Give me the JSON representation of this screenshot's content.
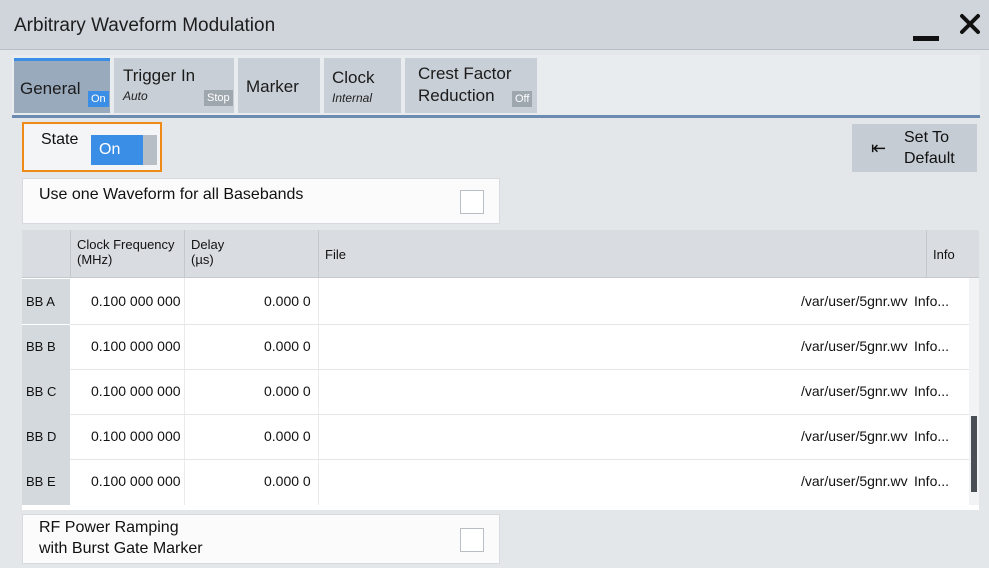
{
  "window": {
    "title": "Arbitrary Waveform Modulation",
    "minimize_icon": "minimize-icon",
    "close_icon": "close-icon"
  },
  "tabs": [
    {
      "name": "General",
      "badge": "On"
    },
    {
      "name": "Trigger In",
      "sub": "Auto",
      "badge": "Stop"
    },
    {
      "name": "Marker"
    },
    {
      "name": "Clock",
      "sub": "Internal"
    },
    {
      "name_line1": "Crest Factor",
      "name_line2": "Reduction",
      "badge": "Off"
    }
  ],
  "state": {
    "label": "State",
    "value": "On"
  },
  "set_default": {
    "line1": "Set To",
    "line2": "Default",
    "icon": "arrow-to-left-icon"
  },
  "use_one_waveform": {
    "label": "Use one Waveform for all Basebands",
    "checked": false
  },
  "table": {
    "headers": {
      "clock_line1": "Clock Frequency",
      "clock_line2": "(MHz)",
      "delay_line1": "Delay",
      "delay_line2": "(µs)",
      "file": "File",
      "info": "Info"
    },
    "rows": [
      {
        "bb": "BB A",
        "clock": "0.100 000 000",
        "delay": "0.000 0",
        "file": "/var/user/5gnr.wv",
        "info": "Info..."
      },
      {
        "bb": "BB B",
        "clock": "0.100 000 000",
        "delay": "0.000 0",
        "file": "/var/user/5gnr.wv",
        "info": "Info..."
      },
      {
        "bb": "BB C",
        "clock": "0.100 000 000",
        "delay": "0.000 0",
        "file": "/var/user/5gnr.wv",
        "info": "Info..."
      },
      {
        "bb": "BB D",
        "clock": "0.100 000 000",
        "delay": "0.000 0",
        "file": "/var/user/5gnr.wv",
        "info": "Info..."
      },
      {
        "bb": "BB E",
        "clock": "0.100 000 000",
        "delay": "0.000 0",
        "file": "/var/user/5gnr.wv",
        "info": "Info..."
      }
    ]
  },
  "rf_power_ramping": {
    "line1": "RF Power Ramping",
    "line2": "with Burst Gate Marker",
    "checked": false
  },
  "colors": {
    "accent": "#3a8ee6",
    "highlight": "#f08a16",
    "tab_active": "#9aaabd",
    "titlebar": "#cfd5db"
  }
}
